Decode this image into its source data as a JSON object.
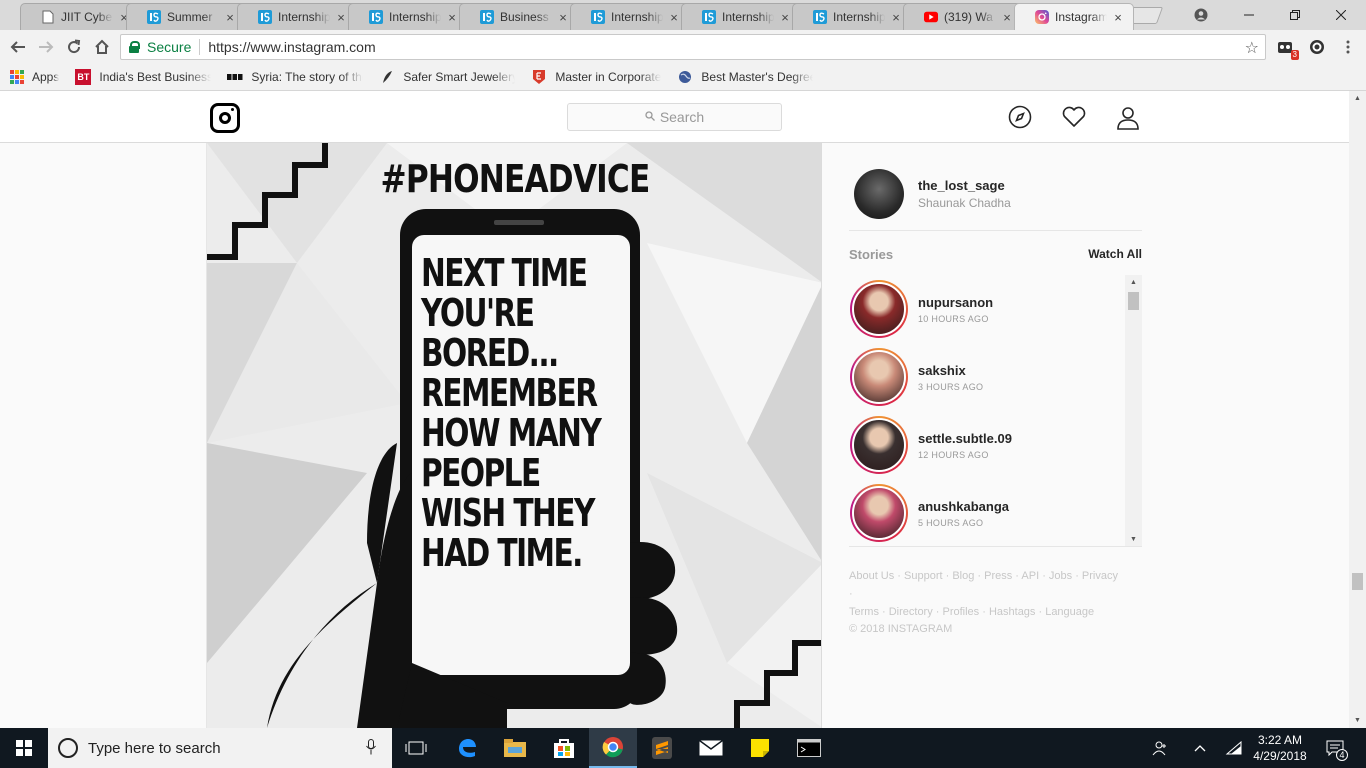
{
  "browser": {
    "tabs": [
      {
        "title": "JIIT Cyber",
        "icon": "page-icon"
      },
      {
        "title": "Summer",
        "icon": "internshala-icon"
      },
      {
        "title": "Internship",
        "icon": "internshala-icon"
      },
      {
        "title": "Internship",
        "icon": "internshala-icon"
      },
      {
        "title": "Business",
        "icon": "internshala-icon"
      },
      {
        "title": "Internship",
        "icon": "internshala-icon"
      },
      {
        "title": "Internship",
        "icon": "internshala-icon"
      },
      {
        "title": "Internship",
        "icon": "internshala-icon"
      },
      {
        "title": "(319) Wa",
        "icon": "youtube-icon"
      },
      {
        "title": "Instagram",
        "icon": "instagram-icon",
        "active": true
      }
    ],
    "tab_close": "×",
    "security_label": "Secure",
    "url": "https://www.instagram.com",
    "extension_badge": "3",
    "bookmarks": [
      {
        "label": "Apps",
        "icon": "apps-grid-icon"
      },
      {
        "label": "India's Best Business",
        "icon": "bt-icon"
      },
      {
        "label": "Syria: The story of the",
        "icon": "bbc-icon"
      },
      {
        "label": "Safer Smart Jewelery",
        "icon": "feather-icon"
      },
      {
        "label": "Master in Corporate",
        "icon": "e-shield-icon"
      },
      {
        "label": "Best Master's Degree",
        "icon": "globe-icon"
      }
    ]
  },
  "instagram": {
    "search_placeholder": "Search",
    "post": {
      "hashtag": "#PHONEADVICE",
      "message": "NEXT TIME\nYOU'RE\nBORED...\nREMEMBER\nHOW MANY\nPEOPLE\nWISH THEY\nHAD TIME."
    },
    "profile": {
      "username": "the_lost_sage",
      "full_name": "Shaunak Chadha"
    },
    "stories_label": "Stories",
    "watch_all": "Watch All",
    "stories": [
      {
        "user": "nupursanon",
        "time": "10 HOURS AGO",
        "color": "#8a2a2a"
      },
      {
        "user": "sakshix",
        "time": "3 HOURS AGO",
        "color": "#c98a78"
      },
      {
        "user": "settle.subtle.09",
        "time": "12 HOURS AGO",
        "color": "#3a3030"
      },
      {
        "user": "anushkabanga",
        "time": "5 HOURS AGO",
        "color": "#c04a6a"
      }
    ],
    "footer_line1": "About Us · Support · Blog · Press · API · Jobs · Privacy ·",
    "footer_line2": "Terms · Directory · Profiles · Hashtags · Language",
    "copyright": "© 2018 INSTAGRAM"
  },
  "taskbar": {
    "search_placeholder": "Type here to search",
    "time": "3:22 AM",
    "date": "4/29/2018",
    "notification_count": "4"
  },
  "colors": {
    "secure_green": "#0b8043",
    "taskbar_bg": "#101820",
    "ig_border": "#dbdbdb"
  }
}
